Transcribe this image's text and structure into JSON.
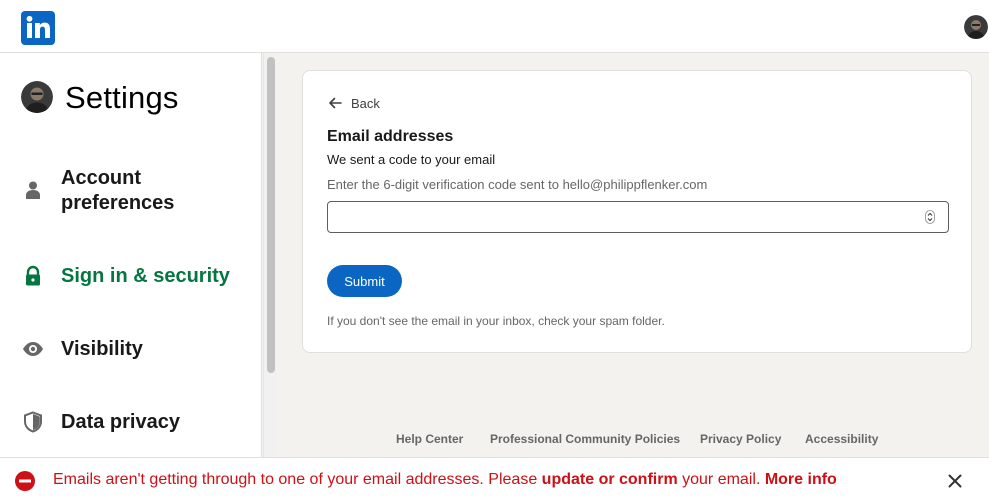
{
  "header": {
    "logo_icon": "linkedin-logo-icon",
    "avatar_icon": "profile-avatar"
  },
  "sidebar": {
    "title": "Settings",
    "items": [
      {
        "label": "Account preferences",
        "icon": "person-icon",
        "active": false
      },
      {
        "label": "Sign in & security",
        "icon": "lock-icon",
        "active": true
      },
      {
        "label": "Visibility",
        "icon": "eye-icon",
        "active": false
      },
      {
        "label": "Data privacy",
        "icon": "shield-icon",
        "active": false
      }
    ]
  },
  "card": {
    "back_label": "Back",
    "title": "Email addresses",
    "subtitle": "We sent a code to your email",
    "hint": "Enter the 6-digit verification code sent to hello@philippflenker.com",
    "input_value": "",
    "submit_label": "Submit",
    "footnote": "If you don't see the email in your inbox, check your spam folder."
  },
  "footer": {
    "links": [
      "Help Center",
      "Professional Community Policies",
      "Privacy Policy",
      "Accessibility"
    ]
  },
  "alert": {
    "text_before": "Emails aren't getting through to one of your email addresses. Please ",
    "link_update": "update or confirm",
    "text_after": " your email. ",
    "link_more": "More info"
  },
  "colors": {
    "brand": "#0a66c2",
    "active_nav": "#057642",
    "alert": "#cc1016"
  }
}
